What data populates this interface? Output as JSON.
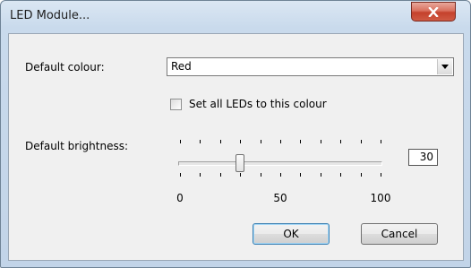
{
  "window": {
    "title": "LED Module...",
    "close_icon": "close-x-icon"
  },
  "form": {
    "colour_label": "Default colour:",
    "colour_value": "Red",
    "colour_dropdown_icon": "chevron-down-icon",
    "set_all_label": "Set all LEDs to this colour",
    "set_all_checked": false,
    "brightness_label": "Default brightness:",
    "brightness_value": "30",
    "slider": {
      "min": 0,
      "max": 100,
      "value": 30,
      "tick_labels": [
        "0",
        "50",
        "100"
      ]
    }
  },
  "buttons": {
    "ok": "OK",
    "cancel": "Cancel"
  },
  "colors": {
    "titlebar": "#c9daec",
    "close_button": "#c4412c",
    "client_bg": "#f0f0f0"
  }
}
